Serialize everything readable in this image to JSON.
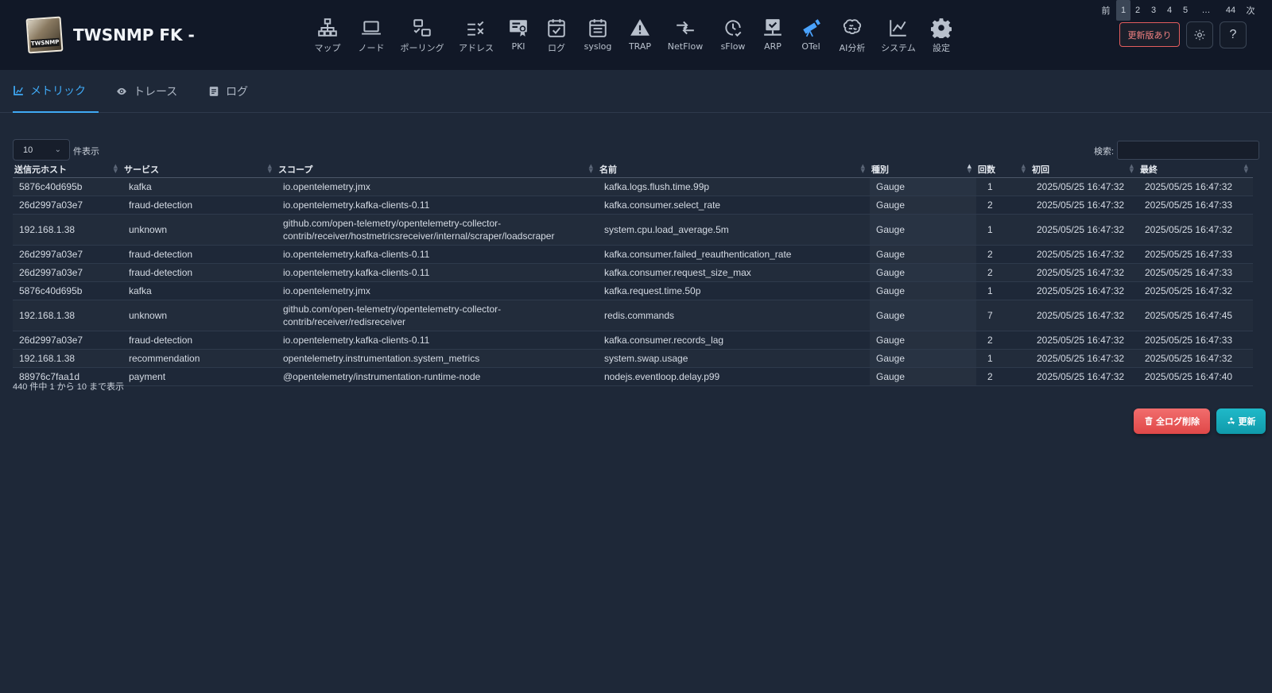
{
  "header": {
    "app_title": "TWSNMP FK -",
    "logo_text": "TWSNMP",
    "update_badge": "更新版あり",
    "help_label": "?"
  },
  "nav": [
    {
      "label": "マップ",
      "icon": "sitemap-icon"
    },
    {
      "label": "ノード",
      "icon": "laptop-icon"
    },
    {
      "label": "ポーリング",
      "icon": "polling-icon"
    },
    {
      "label": "アドレス",
      "icon": "address-check-icon"
    },
    {
      "label": "PKI",
      "icon": "certificate-icon"
    },
    {
      "label": "ログ",
      "icon": "calendar-check-icon"
    },
    {
      "label": "syslog",
      "icon": "calendar-list-icon"
    },
    {
      "label": "TRAP",
      "icon": "warning-icon"
    },
    {
      "label": "NetFlow",
      "icon": "arrows-icon"
    },
    {
      "label": "sFlow",
      "icon": "clock-check-icon"
    },
    {
      "label": "ARP",
      "icon": "network-check-icon"
    },
    {
      "label": "OTel",
      "icon": "telescope-icon"
    },
    {
      "label": "AI分析",
      "icon": "brain-icon"
    },
    {
      "label": "システム",
      "icon": "line-chart-icon"
    },
    {
      "label": "設定",
      "icon": "gear-icon"
    }
  ],
  "tabs": [
    {
      "label": "メトリック",
      "icon": "chart-icon",
      "active": true
    },
    {
      "label": "トレース",
      "icon": "eye-icon",
      "active": false
    },
    {
      "label": "ログ",
      "icon": "document-icon",
      "active": false
    }
  ],
  "controls": {
    "page_length": "10",
    "page_length_suffix": "件表示",
    "search_label": "検索:",
    "search_value": ""
  },
  "table": {
    "columns": [
      "送信元ホスト",
      "サービス",
      "スコープ",
      "名前",
      "種別",
      "回数",
      "初回",
      "最終"
    ],
    "rows": [
      [
        "5876c40d695b",
        "kafka",
        "io.opentelemetry.jmx",
        "kafka.logs.flush.time.99p",
        "Gauge",
        "1",
        "2025/05/25 16:47:32",
        "2025/05/25 16:47:32"
      ],
      [
        "26d2997a03e7",
        "fraud-detection",
        "io.opentelemetry.kafka-clients-0.11",
        "kafka.consumer.select_rate",
        "Gauge",
        "2",
        "2025/05/25 16:47:32",
        "2025/05/25 16:47:33"
      ],
      [
        "192.168.1.38",
        "unknown",
        "github.com/open-telemetry/opentelemetry-collector-contrib/receiver/hostmetricsreceiver/internal/scraper/loadscraper",
        "system.cpu.load_average.5m",
        "Gauge",
        "1",
        "2025/05/25 16:47:32",
        "2025/05/25 16:47:32"
      ],
      [
        "26d2997a03e7",
        "fraud-detection",
        "io.opentelemetry.kafka-clients-0.11",
        "kafka.consumer.failed_reauthentication_rate",
        "Gauge",
        "2",
        "2025/05/25 16:47:32",
        "2025/05/25 16:47:33"
      ],
      [
        "26d2997a03e7",
        "fraud-detection",
        "io.opentelemetry.kafka-clients-0.11",
        "kafka.consumer.request_size_max",
        "Gauge",
        "2",
        "2025/05/25 16:47:32",
        "2025/05/25 16:47:33"
      ],
      [
        "5876c40d695b",
        "kafka",
        "io.opentelemetry.jmx",
        "kafka.request.time.50p",
        "Gauge",
        "1",
        "2025/05/25 16:47:32",
        "2025/05/25 16:47:32"
      ],
      [
        "192.168.1.38",
        "unknown",
        "github.com/open-telemetry/opentelemetry-collector-contrib/receiver/redisreceiver",
        "redis.commands",
        "Gauge",
        "7",
        "2025/05/25 16:47:32",
        "2025/05/25 16:47:45"
      ],
      [
        "26d2997a03e7",
        "fraud-detection",
        "io.opentelemetry.kafka-clients-0.11",
        "kafka.consumer.records_lag",
        "Gauge",
        "2",
        "2025/05/25 16:47:32",
        "2025/05/25 16:47:33"
      ],
      [
        "192.168.1.38",
        "recommendation",
        "opentelemetry.instrumentation.system_metrics",
        "system.swap.usage",
        "Gauge",
        "1",
        "2025/05/25 16:47:32",
        "2025/05/25 16:47:32"
      ],
      [
        "88976c7faa1d",
        "payment",
        "@opentelemetry/instrumentation-runtime-node",
        "nodejs.eventloop.delay.p99",
        "Gauge",
        "2",
        "2025/05/25 16:47:32",
        "2025/05/25 16:47:40"
      ]
    ]
  },
  "footer": {
    "info": "440 件中 1 から 10 まで表示",
    "pager": [
      "前",
      "1",
      "2",
      "3",
      "4",
      "5",
      "…",
      "44",
      "次"
    ],
    "current_page": "1"
  },
  "actions": {
    "clear_label": "全ログ削除",
    "refresh_label": "更新"
  }
}
